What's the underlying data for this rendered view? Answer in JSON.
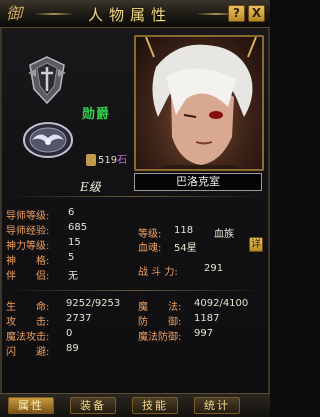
{
  "window": {
    "title": "人物属性",
    "corner_glyph": "御",
    "help_button": "?",
    "close_button": "X"
  },
  "character": {
    "rank_title": "勋爵",
    "gold_value": "519",
    "gold_suffix": "石",
    "level_tag": "E级",
    "name": "巴洛克室"
  },
  "stats_left": [
    {
      "label": "导师等级:",
      "value": "6"
    },
    {
      "label": "导师经验:",
      "value": "685"
    },
    {
      "label": "神力等级:",
      "value": "15"
    },
    {
      "label": "神　　格:",
      "value": "5"
    },
    {
      "label": "伴　　侣:",
      "value": "无"
    }
  ],
  "stats_right": [
    {
      "label": "等级:",
      "value": "118",
      "extra": "血族"
    },
    {
      "label": "血魂:",
      "value": "54星"
    }
  ],
  "combat": {
    "label": "战 斗 力:",
    "value": "291"
  },
  "detail_button": "详",
  "attributes_left": [
    {
      "label": "生　　命:",
      "value": "9252/9253"
    },
    {
      "label": "攻　　击:",
      "value": "2737"
    },
    {
      "label": "魔法攻击:",
      "value": "0"
    },
    {
      "label": "闪　　避:",
      "value": "89"
    }
  ],
  "attributes_right": [
    {
      "label": "魔　　法:",
      "value": "4092/4100"
    },
    {
      "label": "防　　御:",
      "value": "1187"
    },
    {
      "label": "魔法防御:",
      "value": "997"
    }
  ],
  "tabs": [
    {
      "label": "属性",
      "active": true
    },
    {
      "label": "装备",
      "active": false
    },
    {
      "label": "技能",
      "active": false
    },
    {
      "label": "统计",
      "active": false
    }
  ],
  "colors": {
    "accent_gold": "#f2d98a",
    "label_orange": "#f0a060",
    "rank_green": "#32d24a"
  }
}
